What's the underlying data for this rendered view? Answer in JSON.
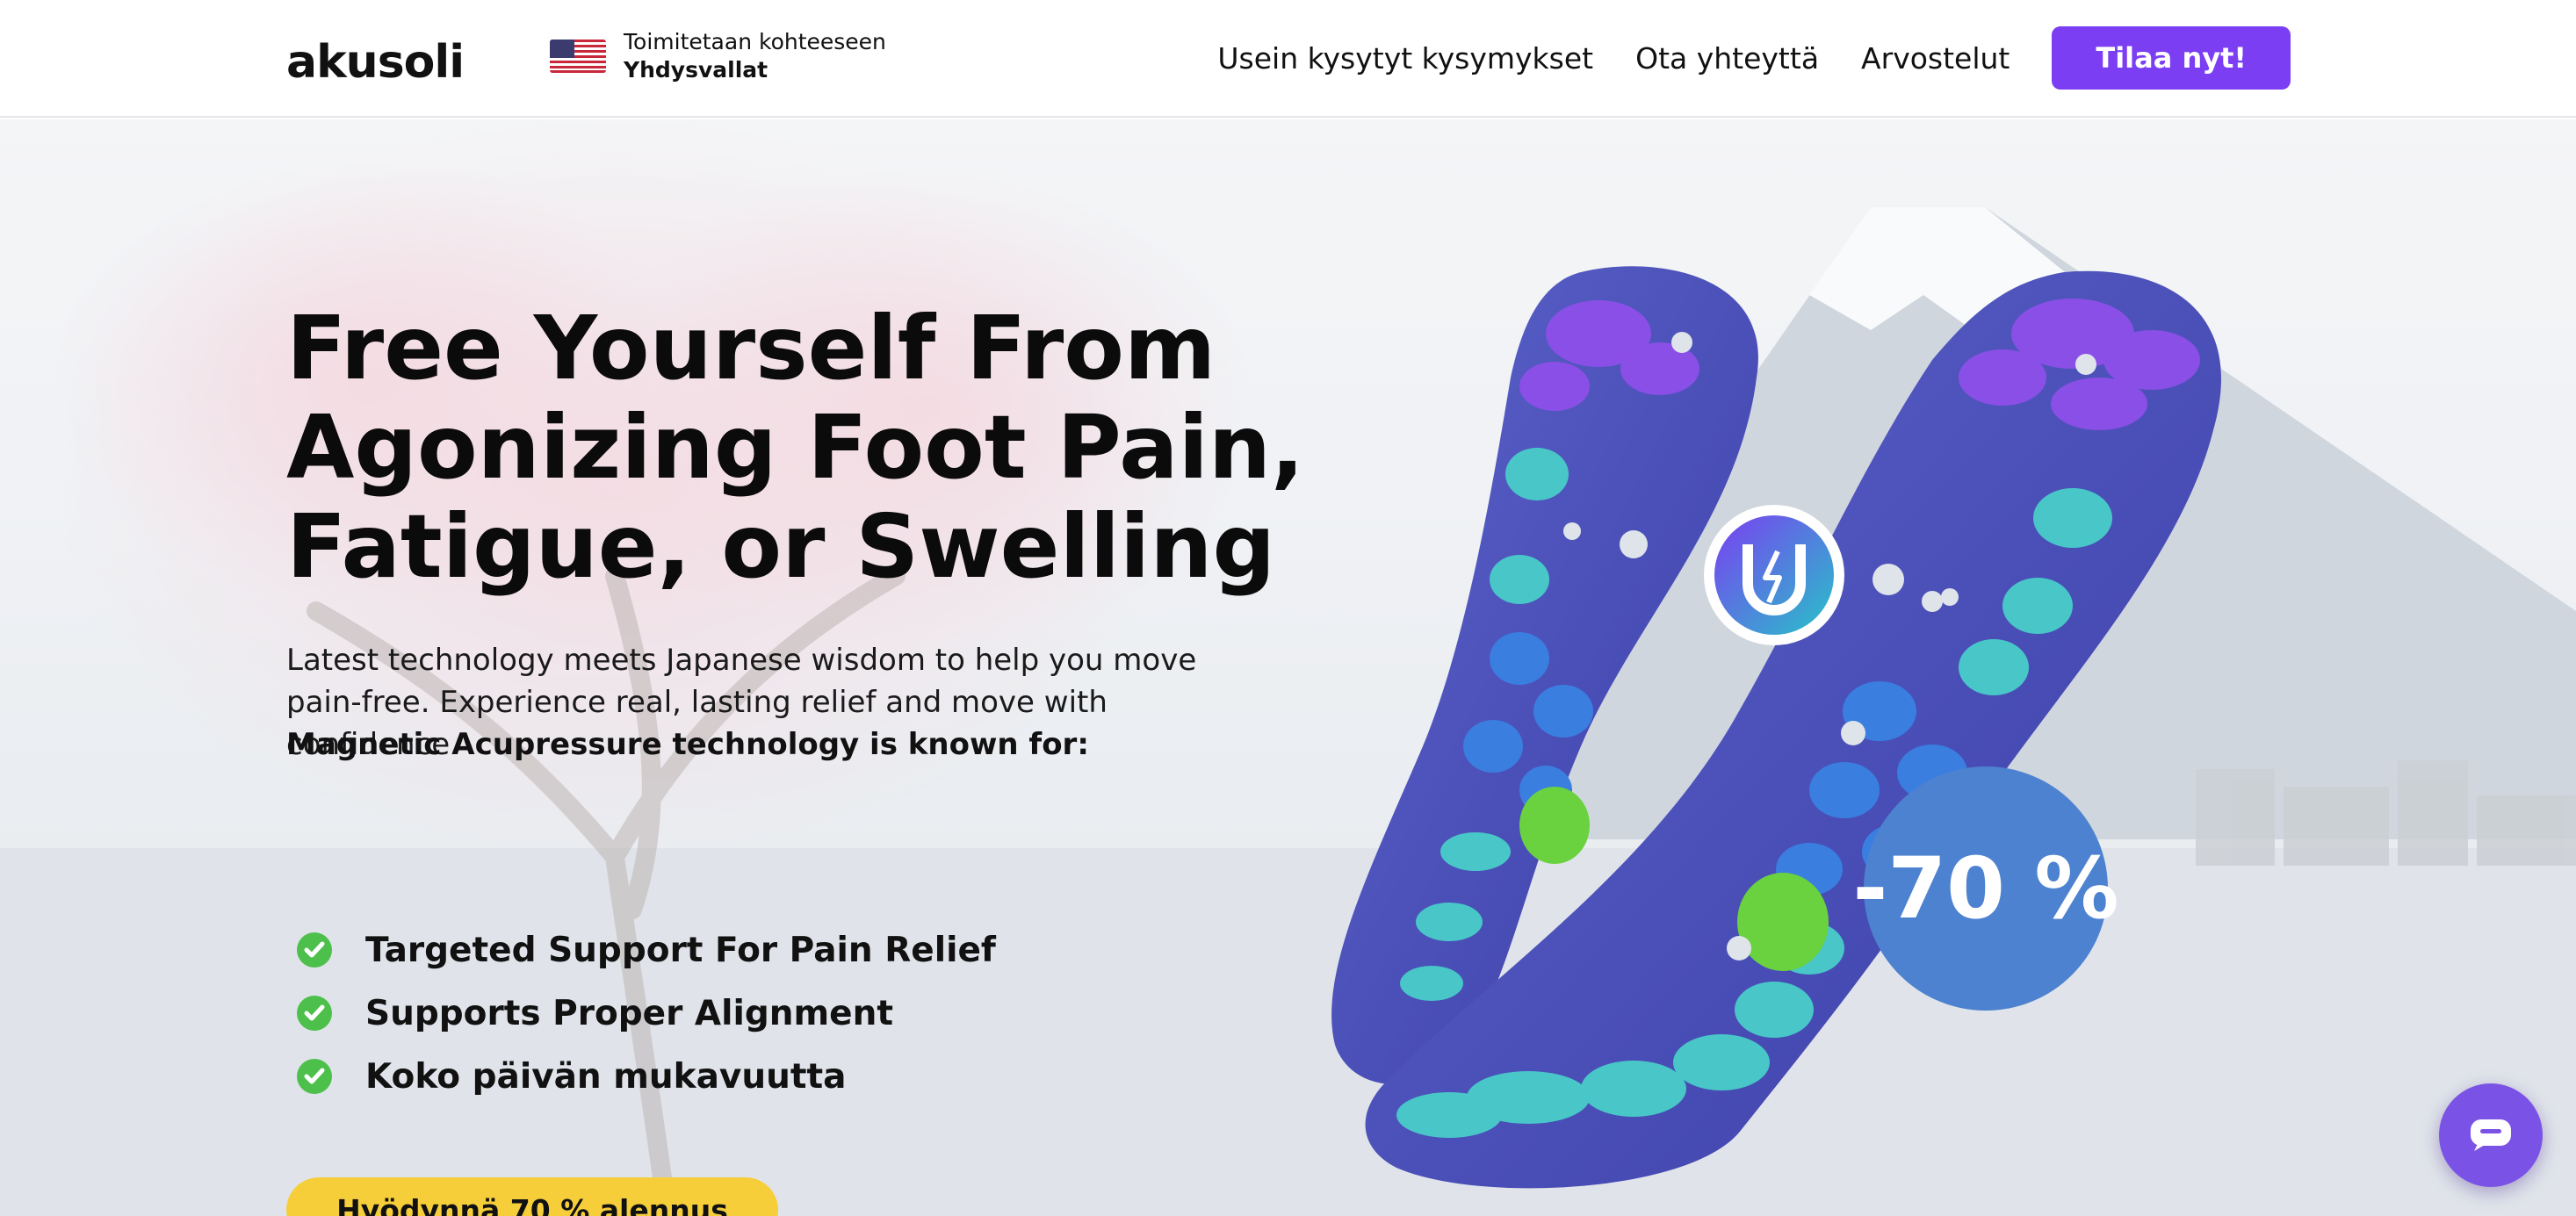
{
  "brand": {
    "logo_text": "akusoli"
  },
  "shipping": {
    "label": "Toimitetaan kohteeseen",
    "country": "Yhdysvallat",
    "flag_icon": "us-flag-icon"
  },
  "nav": {
    "links": [
      "Usein kysytyt kysymykset",
      "Ota yhteyttä",
      "Arvostelut"
    ],
    "order_button": "Tilaa nyt!"
  },
  "hero": {
    "headline": "Free Yourself From Agonizing Foot Pain, Fatigue, or Swelling",
    "lead": "Latest technology meets Japanese wisdom to help you move pain-free. Experience real, lasting relief and move with confidence.",
    "lead_bold": "Magnetic Acupressure technology is known for:",
    "benefits": [
      "Targeted Support For Pain Relief",
      "Supports Proper Alignment",
      "Koko päivän mukavuutta"
    ],
    "cta": "Hyödynnä 70 % alennus",
    "discount_badge": "-70 %"
  },
  "colors": {
    "accent_purple": "#7b3ef2",
    "cta_yellow": "#f6ce3a",
    "badge_blue": "#4d82d0",
    "check_green": "#4cc04a"
  }
}
